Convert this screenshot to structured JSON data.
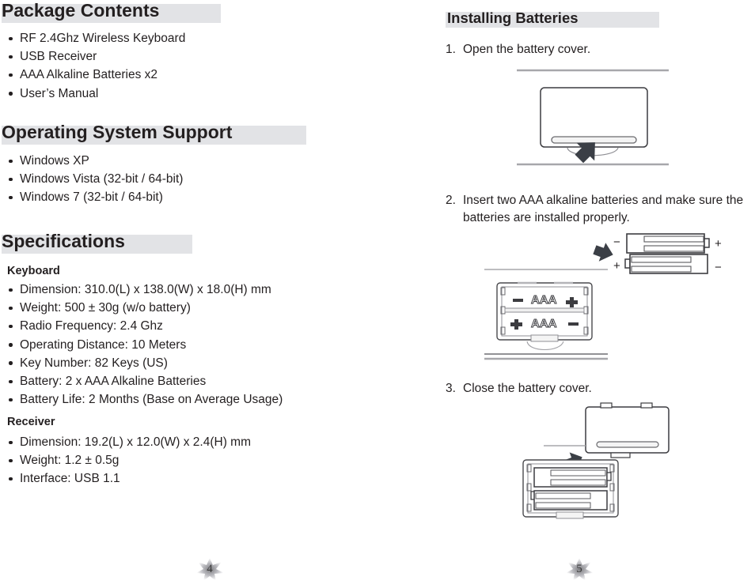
{
  "document": {
    "type": "product-manual-spread",
    "background": "#ffffff",
    "heading_highlight_color": "#e2e3e6",
    "text_color": "#231f20",
    "line_color": "#9a9a9d",
    "arrow_color": "#3b3f46"
  },
  "left_page": {
    "page_number": "4",
    "sections": [
      {
        "heading": "Package Contents",
        "items": [
          "RF 2.4Ghz Wireless Keyboard",
          "USB Receiver",
          "AAA Alkaline Batteries x2",
          "User’s Manual"
        ]
      },
      {
        "heading": "Operating System Support",
        "items": [
          "Windows XP",
          "Windows Vista (32-bit / 64-bit)",
          "Windows 7 (32-bit / 64-bit)"
        ]
      }
    ],
    "specifications": {
      "heading": "Specifications",
      "groups": [
        {
          "subheading": "Keyboard",
          "items": [
            "Dimension: 310.0(L) x 138.0(W) x 18.0(H) mm",
            "Weight: 500 ± 30g (w/o battery)",
            "Radio Frequency: 2.4 Ghz",
            "Operating Distance: 10 Meters",
            "Key Number:  82 Keys (US)",
            "Battery: 2 x AAA Alkaline Batteries",
            "Battery Life: 2 Months (Base on Average Usage)"
          ]
        },
        {
          "subheading": "Receiver",
          "items": [
            "Dimension: 19.2(L) x 12.0(W) x 2.4(H) mm",
            "Weight: 1.2 ± 0.5g",
            "Interface: USB 1.1"
          ]
        }
      ]
    }
  },
  "right_page": {
    "page_number": "5",
    "heading": "Installing Batteries",
    "steps": [
      {
        "number": "1.",
        "text": "Open the battery cover.",
        "figure": "keyboard-underside-cover-open"
      },
      {
        "number": "2.",
        "text": "Insert two AAA alkaline batteries and make sure the batteries are installed properly.",
        "figure": "battery-compartment-polarity"
      },
      {
        "number": "3.",
        "text": "Close the battery cover.",
        "figure": "keyboard-cover-close"
      }
    ],
    "battery_diagram": {
      "loose_batteries": [
        {
          "left_terminal": "−",
          "right_terminal": "+"
        },
        {
          "left_terminal": "+",
          "right_terminal": "−"
        }
      ],
      "compartment_slots": [
        {
          "left_mark": "−",
          "label": "AAA",
          "right_mark": "+"
        },
        {
          "left_mark": "+",
          "label": "AAA",
          "right_mark": "−"
        }
      ]
    }
  }
}
